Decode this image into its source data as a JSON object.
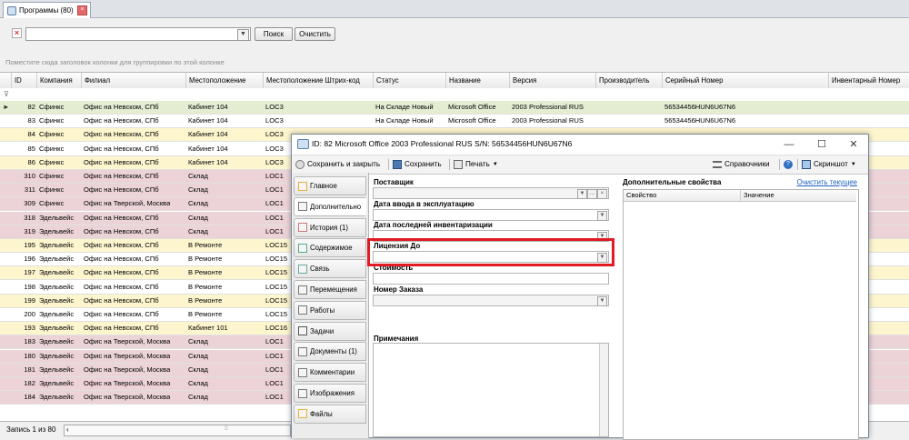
{
  "tab": {
    "title": "Программы (80)"
  },
  "filter": {
    "search_label": "Поиск",
    "clear_label": "Очистить",
    "group_hint": "Поместите сюда заголовок колонки для группировки по этой колонке"
  },
  "grid": {
    "columns": [
      "ID",
      "Компания",
      "Филиал",
      "Местоположение",
      "Местоположение Штрих-код",
      "Статус",
      "Название",
      "Версия",
      "Производитель",
      "Серийный Номер",
      "Инвентарный Номер"
    ],
    "rows": [
      {
        "id": "82",
        "company": "Сфинкс",
        "branch": "Офис на Невском, СПб",
        "location": "Кабинет 104",
        "barcode": "LOC3",
        "status": "На Складе Новый",
        "name": "Microsoft Office",
        "version": "2003 Professional RUS",
        "serial": "56534456HUN6U67N6",
        "bg": "#e4ecd2"
      },
      {
        "id": "83",
        "company": "Сфинкс",
        "branch": "Офис на Невском, СПб",
        "location": "Кабинет 104",
        "barcode": "LOC3",
        "status": "На Складе Новый",
        "name": "Microsoft Office",
        "version": "2003 Professional RUS",
        "serial": "56534456HUN6U67N6",
        "bg": "#ffffff"
      },
      {
        "id": "84",
        "company": "Сфинкс",
        "branch": "Офис на Невском, СПб",
        "location": "Кабинет 104",
        "barcode": "LOC3",
        "status": "",
        "name": "",
        "version": "",
        "serial": "",
        "bg": "#fdf5cd"
      },
      {
        "id": "85",
        "company": "Сфинкс",
        "branch": "Офис на Невском, СПб",
        "location": "Кабинет 104",
        "barcode": "LOC3",
        "status": "",
        "name": "",
        "version": "",
        "serial": "",
        "bg": "#ffffff"
      },
      {
        "id": "86",
        "company": "Сфинкс",
        "branch": "Офис на Невском, СПб",
        "location": "Кабинет 104",
        "barcode": "LOC3",
        "status": "",
        "name": "",
        "version": "",
        "serial": "",
        "bg": "#fdf5cd"
      },
      {
        "id": "310",
        "company": "Сфинкс",
        "branch": "Офис на Невском, СПб",
        "location": "Склад",
        "barcode": "LOC1",
        "status": "",
        "name": "",
        "version": "",
        "serial": "",
        "bg": "#ecd3d8"
      },
      {
        "id": "311",
        "company": "Сфинкс",
        "branch": "Офис на Невском, СПб",
        "location": "Склад",
        "barcode": "LOC1",
        "status": "",
        "name": "",
        "version": "",
        "serial": "",
        "bg": "#ecd3d8"
      },
      {
        "id": "309",
        "company": "Сфинкс",
        "branch": "Офис на Тверской, Москва",
        "location": "Склад",
        "barcode": "LOC1",
        "status": "",
        "name": "",
        "version": "",
        "serial": "",
        "bg": "#ecd3d8"
      },
      {
        "id": "318",
        "company": "Эдельвейс",
        "branch": "Офис на Невском, СПб",
        "location": "Склад",
        "barcode": "LOC1",
        "status": "",
        "name": "",
        "version": "",
        "serial": "",
        "bg": "#ecd3d8"
      },
      {
        "id": "319",
        "company": "Эдельвейс",
        "branch": "Офис на Невском, СПб",
        "location": "Склад",
        "barcode": "LOC1",
        "status": "",
        "name": "",
        "version": "",
        "serial": "",
        "bg": "#ecd3d8"
      },
      {
        "id": "195",
        "company": "Эдельвейс",
        "branch": "Офис на Невском, СПб",
        "location": "В Ремонте",
        "barcode": "LOC15",
        "status": "",
        "name": "",
        "version": "",
        "serial": "",
        "bg": "#fdf5cd"
      },
      {
        "id": "196",
        "company": "Эдельвейс",
        "branch": "Офис на Невском, СПб",
        "location": "В Ремонте",
        "barcode": "LOC15",
        "status": "",
        "name": "",
        "version": "",
        "serial": "",
        "bg": "#ffffff"
      },
      {
        "id": "197",
        "company": "Эдельвейс",
        "branch": "Офис на Невском, СПб",
        "location": "В Ремонте",
        "barcode": "LOC15",
        "status": "",
        "name": "",
        "version": "",
        "serial": "",
        "bg": "#fdf5cd"
      },
      {
        "id": "198",
        "company": "Эдельвейс",
        "branch": "Офис на Невском, СПб",
        "location": "В Ремонте",
        "barcode": "LOC15",
        "status": "",
        "name": "",
        "version": "",
        "serial": "",
        "bg": "#ffffff"
      },
      {
        "id": "199",
        "company": "Эдельвейс",
        "branch": "Офис на Невском, СПб",
        "location": "В Ремонте",
        "barcode": "LOC15",
        "status": "",
        "name": "",
        "version": "",
        "serial": "",
        "bg": "#fdf5cd"
      },
      {
        "id": "200",
        "company": "Эдельвейс",
        "branch": "Офис на Невском, СПб",
        "location": "В Ремонте",
        "barcode": "LOC15",
        "status": "",
        "name": "",
        "version": "",
        "serial": "",
        "bg": "#ffffff"
      },
      {
        "id": "193",
        "company": "Эдельвейс",
        "branch": "Офис на Невском, СПб",
        "location": "Кабинет 101",
        "barcode": "LOC16",
        "status": "",
        "name": "",
        "version": "",
        "serial": "",
        "bg": "#fdf5cd"
      },
      {
        "id": "183",
        "company": "Эдельвейс",
        "branch": "Офис на Тверской, Москва",
        "location": "Склад",
        "barcode": "LOC1",
        "status": "",
        "name": "",
        "version": "",
        "serial": "",
        "bg": "#ecd3d8"
      },
      {
        "id": "180",
        "company": "Эдельвейс",
        "branch": "Офис на Тверской, Москва",
        "location": "Склад",
        "barcode": "LOC1",
        "status": "",
        "name": "",
        "version": "",
        "serial": "",
        "bg": "#ecd3d8"
      },
      {
        "id": "181",
        "company": "Эдельвейс",
        "branch": "Офис на Тверской, Москва",
        "location": "Склад",
        "barcode": "LOC1",
        "status": "",
        "name": "",
        "version": "",
        "serial": "",
        "bg": "#ecd3d8"
      },
      {
        "id": "182",
        "company": "Эдельвейс",
        "branch": "Офис на Тверской, Москва",
        "location": "Склад",
        "barcode": "LOC1",
        "status": "",
        "name": "",
        "version": "",
        "serial": "",
        "bg": "#ecd3d8"
      },
      {
        "id": "184",
        "company": "Эдельвейс",
        "branch": "Офис на Тверской, Москва",
        "location": "Склад",
        "barcode": "LOC1",
        "status": "",
        "name": "",
        "version": "",
        "serial": "",
        "bg": "#ecd3d8"
      }
    ]
  },
  "status": {
    "record_text": "Запись 1 из 80"
  },
  "dialog": {
    "title": "ID: 82  Microsoft Office 2003 Professional RUS S/N: 56534456HUN6U67N6",
    "save_close": "Сохранить и закрыть",
    "save": "Сохранить",
    "print": "Печать",
    "reference": "Справочники",
    "screenshot": "Скриншот",
    "tabs": [
      "Главное",
      "Дополнительно",
      "История (1)",
      "Содержимое",
      "Связь",
      "Перемещения",
      "Работы",
      "Задачи",
      "Документы (1)",
      "Комментарии",
      "Изображения",
      "Файлы"
    ],
    "fields": {
      "supplier": "Поставщик",
      "commission_date": "Дата ввода в эксплуатацию",
      "last_inventory": "Дата последней инвентаризации",
      "license_until": "Лицензия До",
      "cost": "Стоимость",
      "order_number": "Номер Заказа",
      "notes": "Примечания"
    },
    "props": {
      "title": "Дополнительные свойства",
      "show_current": "Очистить текущее",
      "col_property": "Свойство",
      "col_value": "Значение"
    }
  }
}
